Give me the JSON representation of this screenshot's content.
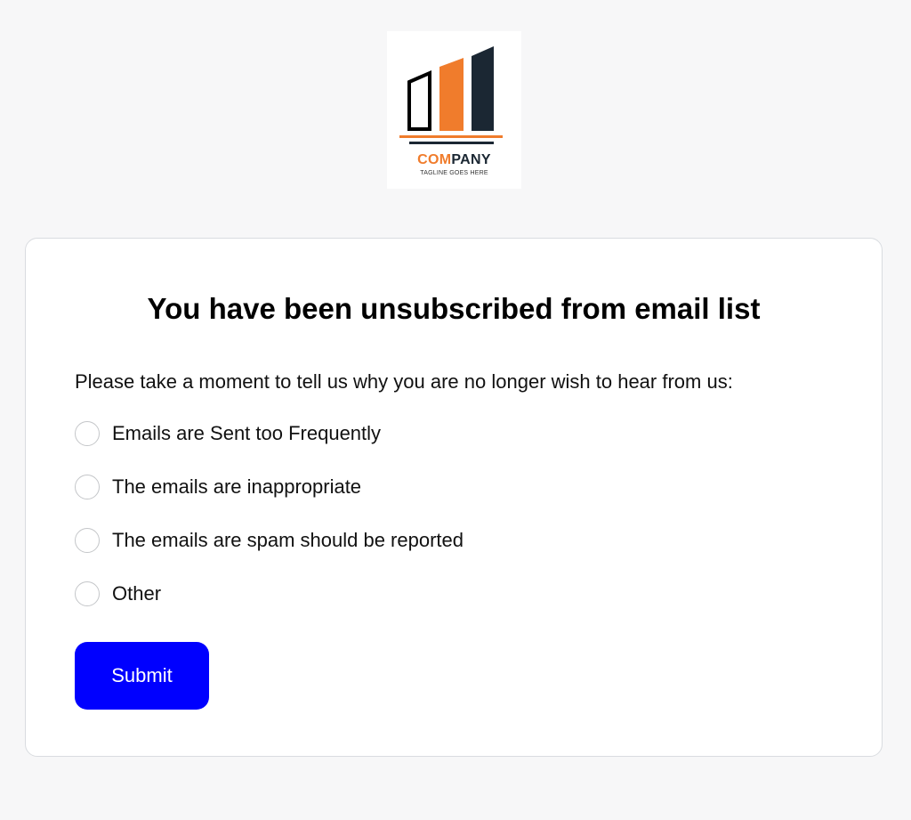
{
  "logo": {
    "word_accent": "COM",
    "word_rest": "PANY",
    "tagline": "TAGLINE GOES HERE",
    "colors": {
      "orange": "#f07c2c",
      "navy": "#1b2733"
    }
  },
  "card": {
    "title": "You have been unsubscribed from email list",
    "prompt": "Please take a moment to tell us why you are no longer wish to hear from us:",
    "options": [
      {
        "label": "Emails are Sent too Frequently",
        "checked": false
      },
      {
        "label": "The emails are inappropriate",
        "checked": false
      },
      {
        "label": "The emails are spam should be reported",
        "checked": false
      },
      {
        "label": "Other",
        "checked": false
      }
    ],
    "submit_label": "Submit",
    "submit_color": "#0000ff"
  }
}
